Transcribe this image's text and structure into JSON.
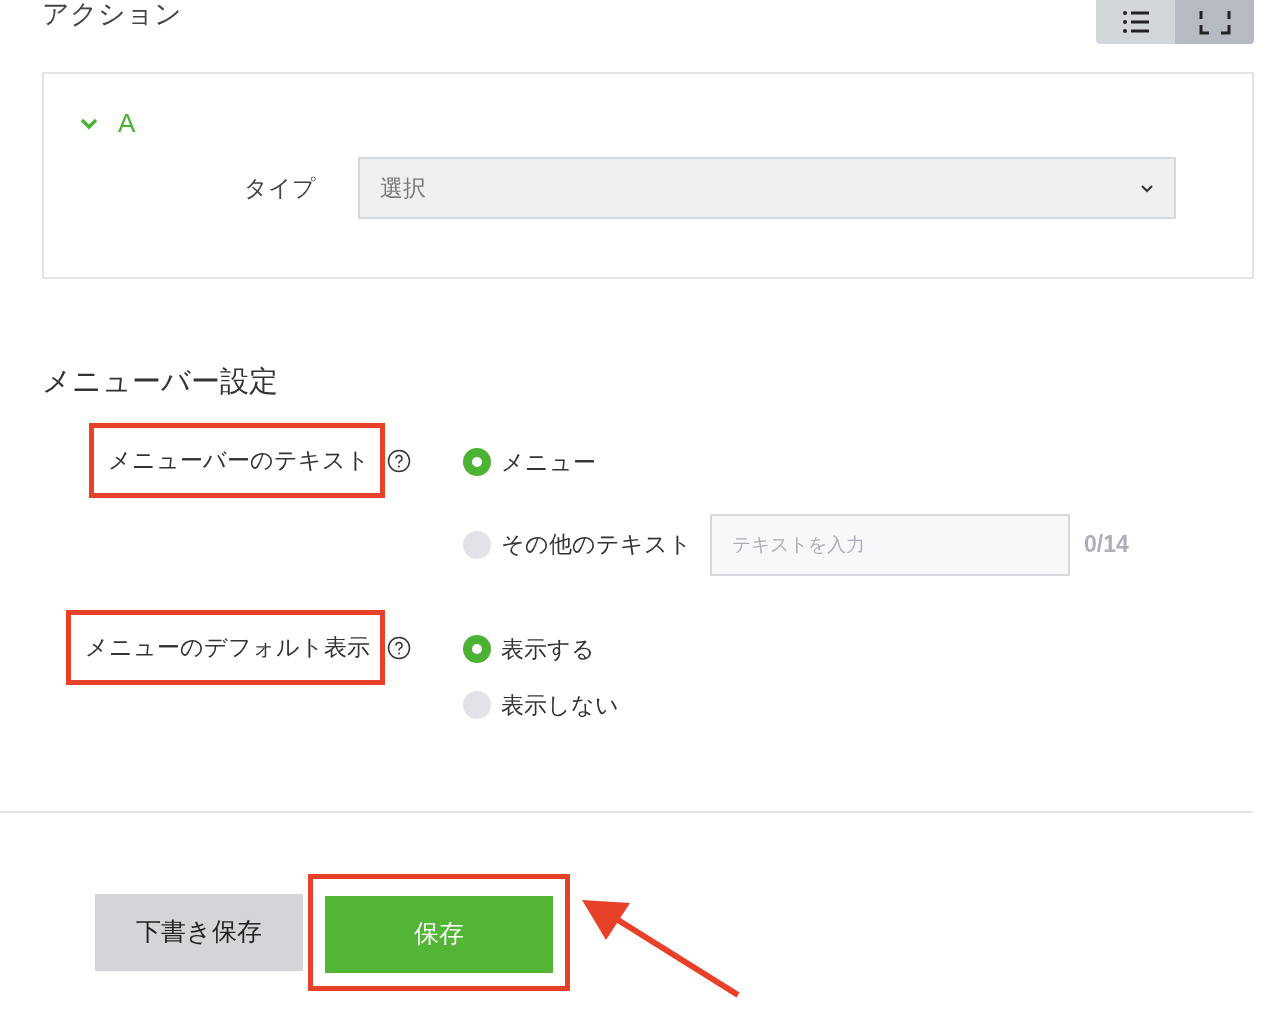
{
  "actions": {
    "title": "アクション",
    "view_toggles": [
      {
        "kind": "list",
        "selected": false
      },
      {
        "kind": "expand",
        "selected": true
      }
    ],
    "items": [
      {
        "label": "A",
        "expanded": true,
        "type_label": "タイプ",
        "type_value": "選択"
      }
    ]
  },
  "menubar_settings": {
    "title": "メニューバー設定",
    "rows": [
      {
        "label": "メニューバーのテキスト",
        "highlighted": true,
        "options": [
          {
            "label": "メニュー",
            "selected": true
          },
          {
            "label": "その他のテキスト",
            "selected": false,
            "input": {
              "placeholder": "テキストを入力",
              "counter": "0/14"
            }
          }
        ]
      },
      {
        "label": "メニューのデフォルト表示",
        "highlighted": true,
        "options": [
          {
            "label": "表示する",
            "selected": true
          },
          {
            "label": "表示しない",
            "selected": false
          }
        ]
      }
    ]
  },
  "buttons": [
    {
      "kind": "secondary",
      "label": "下書き保存",
      "highlighted": false
    },
    {
      "kind": "primary",
      "label": "保存",
      "highlighted": true
    }
  ],
  "callout_arrow": true
}
